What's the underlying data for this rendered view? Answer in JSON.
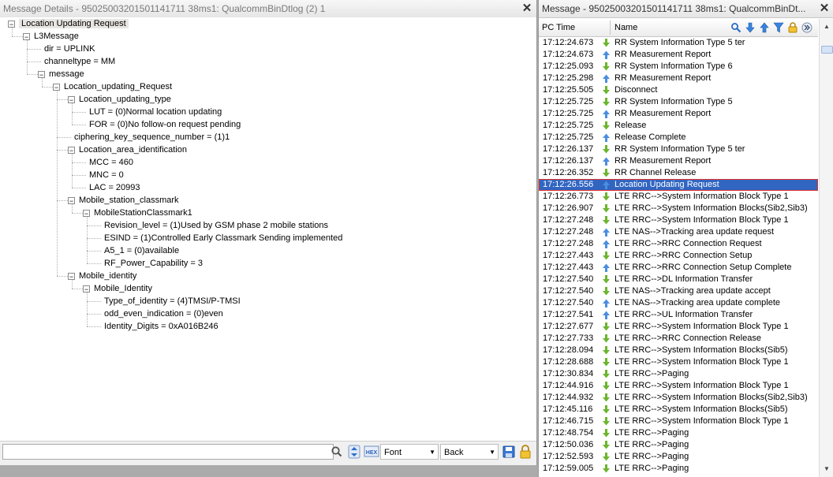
{
  "left": {
    "title": "Message Details - 95025003201501141711 38ms1: QualcommBinDtlog (2) 1",
    "tree": [
      {
        "d": 0,
        "label": "Location Updating Request",
        "toggle": "-",
        "sel": true
      },
      {
        "d": 1,
        "label": "L3Message",
        "toggle": "-"
      },
      {
        "d": 2,
        "label": "dir = UPLINK"
      },
      {
        "d": 2,
        "label": "channeltype = MM"
      },
      {
        "d": 2,
        "label": "message",
        "toggle": "-"
      },
      {
        "d": 3,
        "label": "Location_updating_Request",
        "toggle": "-"
      },
      {
        "d": 4,
        "label": "Location_updating_type",
        "toggle": "-"
      },
      {
        "d": 5,
        "label": "LUT =  (0)Normal location updating"
      },
      {
        "d": 5,
        "label": "FOR =  (0)No follow-on request pending"
      },
      {
        "d": 4,
        "label": "ciphering_key_sequence_number =  (1)1"
      },
      {
        "d": 4,
        "label": "Location_area_identification",
        "toggle": "-"
      },
      {
        "d": 5,
        "label": "MCC = 460"
      },
      {
        "d": 5,
        "label": "MNC = 0"
      },
      {
        "d": 5,
        "label": "LAC = 20993"
      },
      {
        "d": 4,
        "label": "Mobile_station_classmark",
        "toggle": "-"
      },
      {
        "d": 5,
        "label": "MobileStationClassmark1",
        "toggle": "-"
      },
      {
        "d": 6,
        "label": "Revision_level =  (1)Used by GSM phase 2 mobile stations"
      },
      {
        "d": 6,
        "label": "ESIND =  (1)Controlled Early Classmark Sending implemented"
      },
      {
        "d": 6,
        "label": "A5_1 =  (0)available"
      },
      {
        "d": 6,
        "label": "RF_Power_Capability = 3"
      },
      {
        "d": 4,
        "label": "Mobile_identity",
        "toggle": "-"
      },
      {
        "d": 5,
        "label": "Mobile_Identity",
        "toggle": "-"
      },
      {
        "d": 6,
        "label": "Type_of_identity =  (4)TMSI/P-TMSI"
      },
      {
        "d": 6,
        "label": "odd_even_indication =  (0)even"
      },
      {
        "d": 6,
        "label": "Identity_Digits =  0xA016B246"
      }
    ],
    "toolbar": {
      "find_value": "",
      "font_label": "Font",
      "back_label": "Back",
      "icons": [
        "search-icon",
        "up-down-icon",
        "hex-icon",
        "save-icon",
        "lock-icon"
      ]
    }
  },
  "right": {
    "title": "Message - 95025003201501141711 38ms1: QualcommBinDt...",
    "columns": {
      "time": "PC Time",
      "name": "Name"
    },
    "header_icons": [
      "search-icon",
      "arrow-down-icon",
      "arrow-up-icon",
      "filter-icon",
      "lock-icon",
      "more-icon"
    ],
    "rows": [
      {
        "time": "17:12:24.673",
        "dir": "down",
        "name": "RR System Information Type 5 ter"
      },
      {
        "time": "17:12:24.673",
        "dir": "up",
        "name": "RR Measurement Report"
      },
      {
        "time": "17:12:25.093",
        "dir": "down",
        "name": "RR System Information Type 6"
      },
      {
        "time": "17:12:25.298",
        "dir": "up",
        "name": "RR Measurement Report"
      },
      {
        "time": "17:12:25.505",
        "dir": "down",
        "name": "Disconnect"
      },
      {
        "time": "17:12:25.725",
        "dir": "down",
        "name": "RR System Information Type 5"
      },
      {
        "time": "17:12:25.725",
        "dir": "up",
        "name": "RR Measurement Report"
      },
      {
        "time": "17:12:25.725",
        "dir": "down",
        "name": "Release"
      },
      {
        "time": "17:12:25.725",
        "dir": "up",
        "name": "Release Complete"
      },
      {
        "time": "17:12:26.137",
        "dir": "down",
        "name": "RR System Information Type 5 ter"
      },
      {
        "time": "17:12:26.137",
        "dir": "up",
        "name": "RR Measurement Report"
      },
      {
        "time": "17:12:26.352",
        "dir": "down",
        "name": "RR Channel Release"
      },
      {
        "time": "17:12:26.556",
        "dir": "up",
        "name": "Location Updating Request",
        "sel": true
      },
      {
        "time": "17:12:26.773",
        "dir": "down",
        "name": "LTE RRC-->System Information Block Type 1"
      },
      {
        "time": "17:12:26.907",
        "dir": "down",
        "name": "LTE RRC-->System Information Blocks(Sib2,Sib3)"
      },
      {
        "time": "17:12:27.248",
        "dir": "down",
        "name": "LTE RRC-->System Information Block Type 1"
      },
      {
        "time": "17:12:27.248",
        "dir": "up",
        "name": "LTE NAS-->Tracking area update request"
      },
      {
        "time": "17:12:27.248",
        "dir": "up",
        "name": "LTE RRC-->RRC Connection Request"
      },
      {
        "time": "17:12:27.443",
        "dir": "down",
        "name": "LTE RRC-->RRC Connection Setup"
      },
      {
        "time": "17:12:27.443",
        "dir": "up",
        "name": "LTE RRC-->RRC Connection Setup Complete"
      },
      {
        "time": "17:12:27.540",
        "dir": "down",
        "name": "LTE RRC-->DL Information Transfer"
      },
      {
        "time": "17:12:27.540",
        "dir": "down",
        "name": "LTE NAS-->Tracking area update accept"
      },
      {
        "time": "17:12:27.540",
        "dir": "up",
        "name": "LTE NAS-->Tracking area update complete"
      },
      {
        "time": "17:12:27.541",
        "dir": "up",
        "name": "LTE RRC-->UL Information Transfer"
      },
      {
        "time": "17:12:27.677",
        "dir": "down",
        "name": "LTE RRC-->System Information Block Type 1"
      },
      {
        "time": "17:12:27.733",
        "dir": "down",
        "name": "LTE RRC-->RRC Connection Release"
      },
      {
        "time": "17:12:28.094",
        "dir": "down",
        "name": "LTE RRC-->System Information Blocks(Sib5)"
      },
      {
        "time": "17:12:28.688",
        "dir": "down",
        "name": "LTE RRC-->System Information Block Type 1"
      },
      {
        "time": "17:12:30.834",
        "dir": "down",
        "name": "LTE RRC-->Paging"
      },
      {
        "time": "17:12:44.916",
        "dir": "down",
        "name": "LTE RRC-->System Information Block Type 1"
      },
      {
        "time": "17:12:44.932",
        "dir": "down",
        "name": "LTE RRC-->System Information Blocks(Sib2,Sib3)"
      },
      {
        "time": "17:12:45.116",
        "dir": "down",
        "name": "LTE RRC-->System Information Blocks(Sib5)"
      },
      {
        "time": "17:12:46.715",
        "dir": "down",
        "name": "LTE RRC-->System Information Block Type 1"
      },
      {
        "time": "17:12:48.754",
        "dir": "down",
        "name": "LTE RRC-->Paging"
      },
      {
        "time": "17:12:50.036",
        "dir": "down",
        "name": "LTE RRC-->Paging"
      },
      {
        "time": "17:12:52.593",
        "dir": "down",
        "name": "LTE RRC-->Paging"
      },
      {
        "time": "17:12:59.005",
        "dir": "down",
        "name": "LTE RRC-->Paging"
      }
    ]
  },
  "colors": {
    "selection": "#3165c2",
    "selection_outline": "#e0322b",
    "down_arrow": "#6cb52d",
    "up_arrow": "#4a8ee0"
  }
}
